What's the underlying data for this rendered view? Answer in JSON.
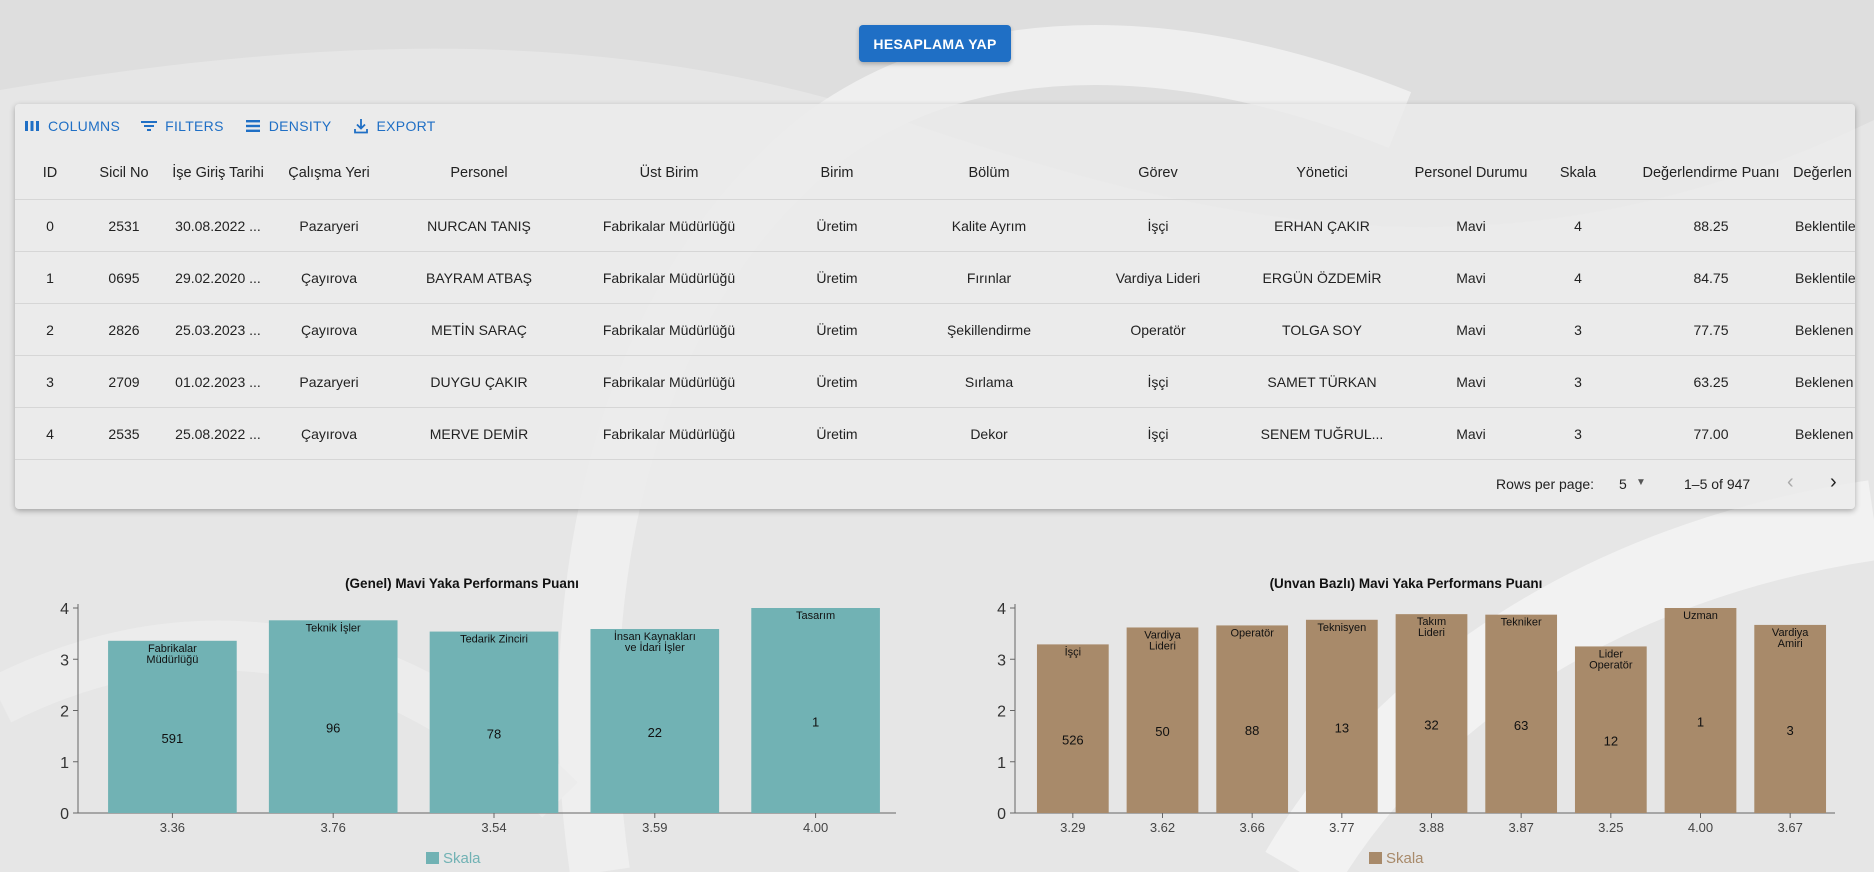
{
  "top_button": "HESAPLAMA YAP",
  "toolbar": {
    "columns": "COLUMNS",
    "filters": "FILTERS",
    "density": "DENSITY",
    "export": "EXPORT"
  },
  "table": {
    "headers": [
      "ID",
      "Sicil No",
      "İşe Giriş Tarihi",
      "Çalışma Yeri",
      "Personel",
      "Üst Birim",
      "Birim",
      "Bölüm",
      "Görev",
      "Yönetici",
      "Personel Durumu",
      "Skala",
      "Değerlendirme Puanı",
      "Değerlen"
    ],
    "rows": [
      [
        "0",
        "2531",
        "30.08.2022 ...",
        "Pazaryeri",
        "NURCAN TANIŞ",
        "Fabrikalar Müdürlüğü",
        "Üretim",
        "Kalite Ayrım",
        "İşçi",
        "ERHAN ÇAKIR",
        "Mavi",
        "4",
        "88.25",
        "Beklentile"
      ],
      [
        "1",
        "0695",
        "29.02.2020 ...",
        "Çayırova",
        "BAYRAM ATBAŞ",
        "Fabrikalar Müdürlüğü",
        "Üretim",
        "Fırınlar",
        "Vardiya Lideri",
        "ERGÜN ÖZDEMİR",
        "Mavi",
        "4",
        "84.75",
        "Beklentile"
      ],
      [
        "2",
        "2826",
        "25.03.2023 ...",
        "Çayırova",
        "METİN SARAÇ",
        "Fabrikalar Müdürlüğü",
        "Üretim",
        "Şekillendirme",
        "Operatör",
        "TOLGA SOY",
        "Mavi",
        "3",
        "77.75",
        "Beklenen"
      ],
      [
        "3",
        "2709",
        "01.02.2023 ...",
        "Pazaryeri",
        "DUYGU ÇAKIR",
        "Fabrikalar Müdürlüğü",
        "Üretim",
        "Sırlama",
        "İşçi",
        "SAMET TÜRKAN",
        "Mavi",
        "3",
        "63.25",
        "Beklenen"
      ],
      [
        "4",
        "2535",
        "25.08.2022 ...",
        "Çayırova",
        "MERVE DEMİR",
        "Fabrikalar Müdürlüğü",
        "Üretim",
        "Dekor",
        "İşçi",
        "SENEM TUĞRUL...",
        "Mavi",
        "3",
        "77.00",
        "Beklenen"
      ]
    ]
  },
  "pagination": {
    "rows_per_page_label": "Rows per page:",
    "rows_per_page_value": "5",
    "range": "1–5 of 947"
  },
  "chart_data": [
    {
      "type": "bar",
      "title": "(Genel) Mavi Yaka Performans Puanı",
      "color": "#71b2b4",
      "legend": "Skala",
      "ylim": [
        0,
        4
      ],
      "yticks": [
        0,
        1,
        2,
        3,
        4
      ],
      "categories": [
        "3.36",
        "3.76",
        "3.54",
        "3.59",
        "4.00"
      ],
      "values": [
        3.36,
        3.76,
        3.54,
        3.59,
        4.0
      ],
      "bar_labels": [
        [
          "Fabrikalar",
          "Müdürlüğü"
        ],
        [
          "Teknik İşler"
        ],
        [
          "Tedarik Zinciri"
        ],
        [
          "İnsan Kaynakları",
          "ve İdari İşler"
        ],
        [
          "Tasarım"
        ]
      ],
      "counts": [
        "591",
        "96",
        "78",
        "22",
        "1"
      ]
    },
    {
      "type": "bar",
      "title": "(Unvan Bazlı) Mavi Yaka Performans Puanı",
      "color": "#a88a6a",
      "legend": "Skala",
      "ylim": [
        0,
        4
      ],
      "yticks": [
        0,
        1,
        2,
        3,
        4
      ],
      "categories": [
        "3.29",
        "3.62",
        "3.66",
        "3.77",
        "3.88",
        "3.87",
        "3.25",
        "4.00",
        "3.67"
      ],
      "values": [
        3.29,
        3.62,
        3.66,
        3.77,
        3.88,
        3.87,
        3.25,
        4.0,
        3.67
      ],
      "bar_labels": [
        [
          "İşçi"
        ],
        [
          "Vardiya",
          "Lideri"
        ],
        [
          "Operatör"
        ],
        [
          "Teknisyen"
        ],
        [
          "Takım",
          "Lideri"
        ],
        [
          "Tekniker"
        ],
        [
          "Lider",
          "Operatör"
        ],
        [
          "Uzman"
        ],
        [
          "Vardiya",
          "Amiri"
        ]
      ],
      "counts": [
        "526",
        "50",
        "88",
        "13",
        "32",
        "63",
        "12",
        "1",
        "3"
      ]
    }
  ]
}
